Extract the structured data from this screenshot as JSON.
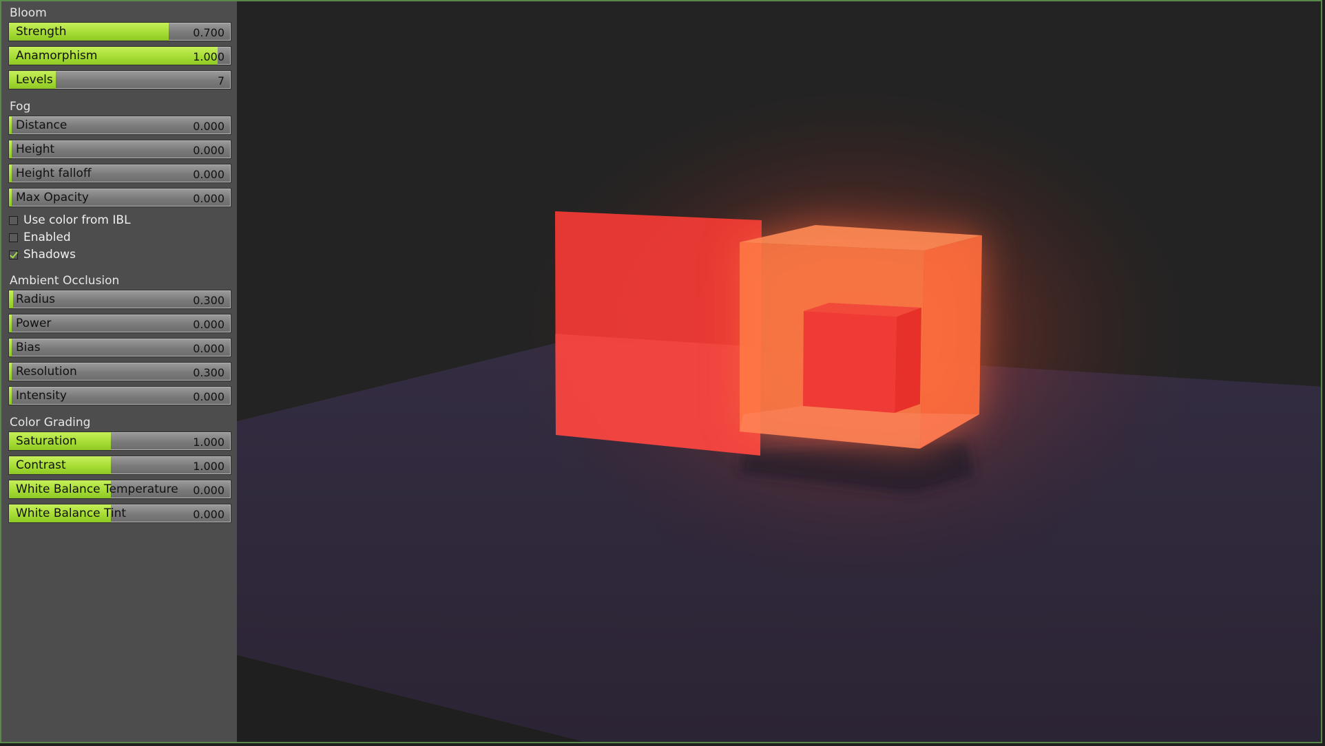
{
  "sections": {
    "bloom": {
      "title": "Bloom",
      "sliders": [
        {
          "label": "Strength",
          "value": "0.700",
          "fill": 0.72
        },
        {
          "label": "Anamorphism",
          "value": "1.000",
          "fill": 0.94
        },
        {
          "label": "Levels",
          "value": "7",
          "fill": 0.21
        }
      ]
    },
    "fog": {
      "title": "Fog",
      "sliders": [
        {
          "label": "Distance",
          "value": "0.000",
          "fill": 0.0
        },
        {
          "label": "Height",
          "value": "0.000",
          "fill": 0.0
        },
        {
          "label": "Height falloff",
          "value": "0.000",
          "fill": 0.0
        },
        {
          "label": "Max Opacity",
          "value": "0.000",
          "fill": 0.0
        }
      ],
      "checkboxes": [
        {
          "label": "Use color from IBL",
          "checked": false
        },
        {
          "label": "Enabled",
          "checked": false
        },
        {
          "label": "Shadows",
          "checked": true
        }
      ]
    },
    "ambient_occlusion": {
      "title": "Ambient Occlusion",
      "sliders": [
        {
          "label": "Radius",
          "value": "0.300",
          "fill": 0.02
        },
        {
          "label": "Power",
          "value": "0.000",
          "fill": 0.0
        },
        {
          "label": "Bias",
          "value": "0.000",
          "fill": 0.0
        },
        {
          "label": "Resolution",
          "value": "0.300",
          "fill": 0.0
        },
        {
          "label": "Intensity",
          "value": "0.000",
          "fill": 0.0
        }
      ]
    },
    "color_grading": {
      "title": "Color Grading",
      "sliders": [
        {
          "label": "Saturation",
          "value": "1.000",
          "fill": 0.46
        },
        {
          "label": "Contrast",
          "value": "1.000",
          "fill": 0.46
        },
        {
          "label": "White Balance Temperature",
          "value": "0.000",
          "fill": 0.46
        },
        {
          "label": "White Balance Tint",
          "value": "0.000",
          "fill": 0.46
        }
      ]
    }
  },
  "colors": {
    "accent": "#a7dd35",
    "panel": "#4d4d4d",
    "background": "#232323",
    "floor": "#2d2738",
    "red_plane": "#ef3a35",
    "orange_cube": "#ff7a45"
  }
}
